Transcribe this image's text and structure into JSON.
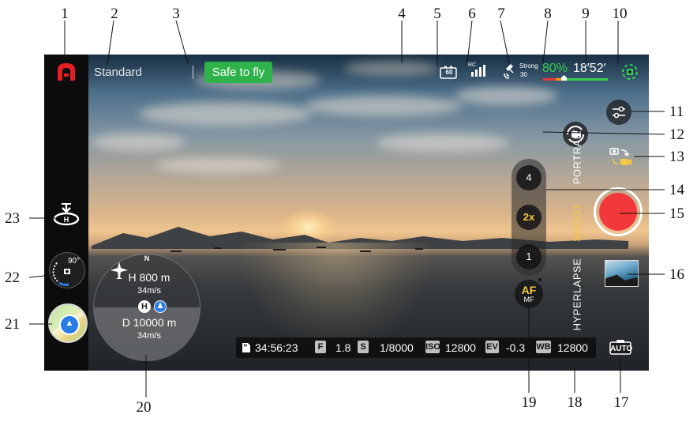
{
  "callouts": [
    "1",
    "2",
    "3",
    "4",
    "5",
    "6",
    "7",
    "8",
    "9",
    "10",
    "11",
    "12",
    "13",
    "14",
    "15",
    "16",
    "17",
    "18",
    "19",
    "20",
    "21",
    "22",
    "23"
  ],
  "top_bar": {
    "flight_mode": "Standard",
    "status": "Safe to fly",
    "battery_level": "60",
    "rc_label": "RC",
    "gps_strength": "Strong",
    "gps_satellites": "30",
    "battery_percent": "80%",
    "flight_time": "18′52′"
  },
  "left_bar": {
    "gimbal_angle": "90°"
  },
  "zoom": {
    "levels": [
      "4",
      "2x",
      "1"
    ],
    "active": "2x"
  },
  "modes": {
    "items": [
      "PORTRAIT",
      "SHOOT",
      "HYPERLAPSE"
    ],
    "active": "SHOOT"
  },
  "focus": {
    "primary": "AF",
    "secondary": "MF"
  },
  "exposure_mode": "AUTO",
  "navigation": {
    "north": "N",
    "height": "H 800 m",
    "vertical_speed": "34m/s",
    "home": "H",
    "distance": "D 10000 m",
    "horizontal_speed": "34m/s"
  },
  "camera_params": {
    "storage_time": "34:56:23",
    "f_tag": "F",
    "aperture": "1.8",
    "s_tag": "S",
    "shutter": "1/8000",
    "iso_tag": "ISO",
    "iso": "12800",
    "ev_tag": "EV",
    "ev": "-0.3",
    "wb_tag": "WB",
    "wb": "12800"
  },
  "colors": {
    "safe_green": "#2db34a",
    "battery_green": "#36d24f",
    "accent_yellow": "#f5c842",
    "shutter_red": "#f2383a",
    "brand_red": "#e31e24"
  }
}
